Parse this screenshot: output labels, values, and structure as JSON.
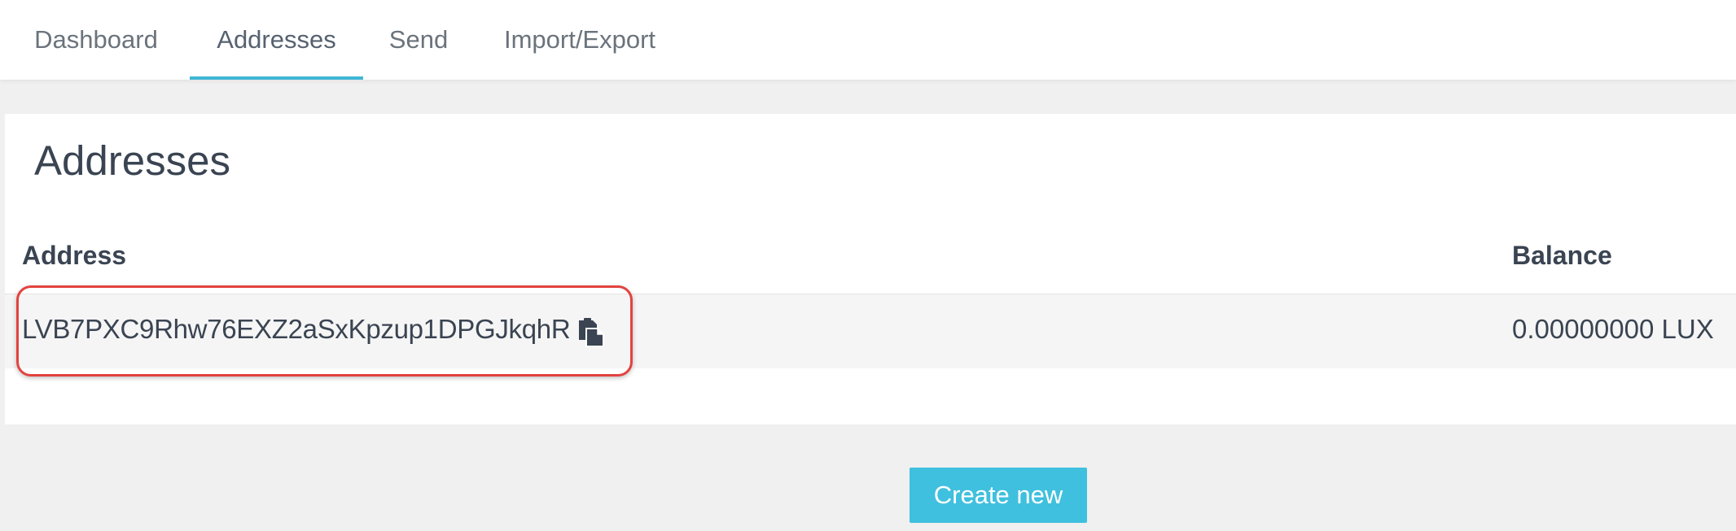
{
  "nav": {
    "tabs": [
      {
        "label": "Dashboard",
        "active": false
      },
      {
        "label": "Addresses",
        "active": true
      },
      {
        "label": "Send",
        "active": false
      },
      {
        "label": "Import/Export",
        "active": false
      }
    ],
    "active_color": "#3fb7d5"
  },
  "card": {
    "title": "Addresses",
    "columns": {
      "address": "Address",
      "balance": "Balance"
    },
    "rows": [
      {
        "address": "LVB7PXC9Rhw76EXZ2aSxKpzup1DPGJkqhR",
        "balance": "0.00000000 LUX",
        "highlighted": true
      }
    ],
    "highlight_color": "#e2433f"
  },
  "actions": {
    "create_label": "Create new",
    "button_color": "#3fc0de"
  },
  "icons": {
    "copy": "copy-icon"
  }
}
